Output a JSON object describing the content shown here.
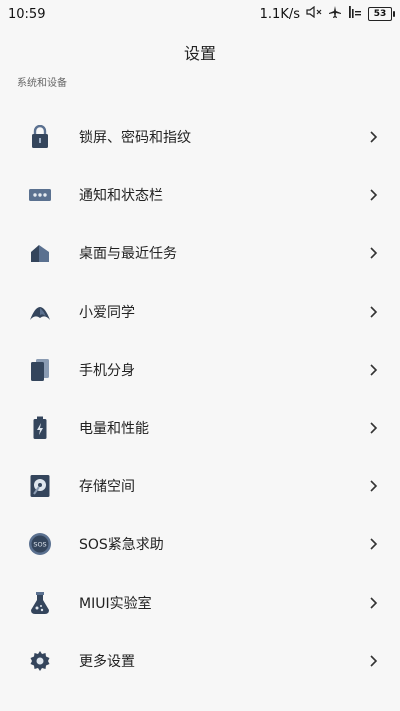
{
  "status_bar": {
    "time": "10:59",
    "net_speed": "1.1K/s",
    "battery": "53"
  },
  "header": {
    "title": "设置"
  },
  "section": {
    "label": "系统和设备"
  },
  "menu": {
    "items": [
      {
        "label": "锁屏、密码和指纹",
        "icon": "lock-icon"
      },
      {
        "label": "通知和状态栏",
        "icon": "notification-icon"
      },
      {
        "label": "桌面与最近任务",
        "icon": "home-icon"
      },
      {
        "label": "小爱同学",
        "icon": "assistant-icon"
      },
      {
        "label": "手机分身",
        "icon": "second-space-icon"
      },
      {
        "label": "电量和性能",
        "icon": "battery-icon"
      },
      {
        "label": "存储空间",
        "icon": "storage-icon"
      },
      {
        "label": "SOS紧急求助",
        "icon": "sos-icon"
      },
      {
        "label": "MIUI实验室",
        "icon": "lab-flask-icon"
      },
      {
        "label": "更多设置",
        "icon": "gear-icon"
      }
    ]
  },
  "colors": {
    "icon": "#34455c",
    "icon_light": "#5b7190",
    "background": "#f7f7f7"
  }
}
